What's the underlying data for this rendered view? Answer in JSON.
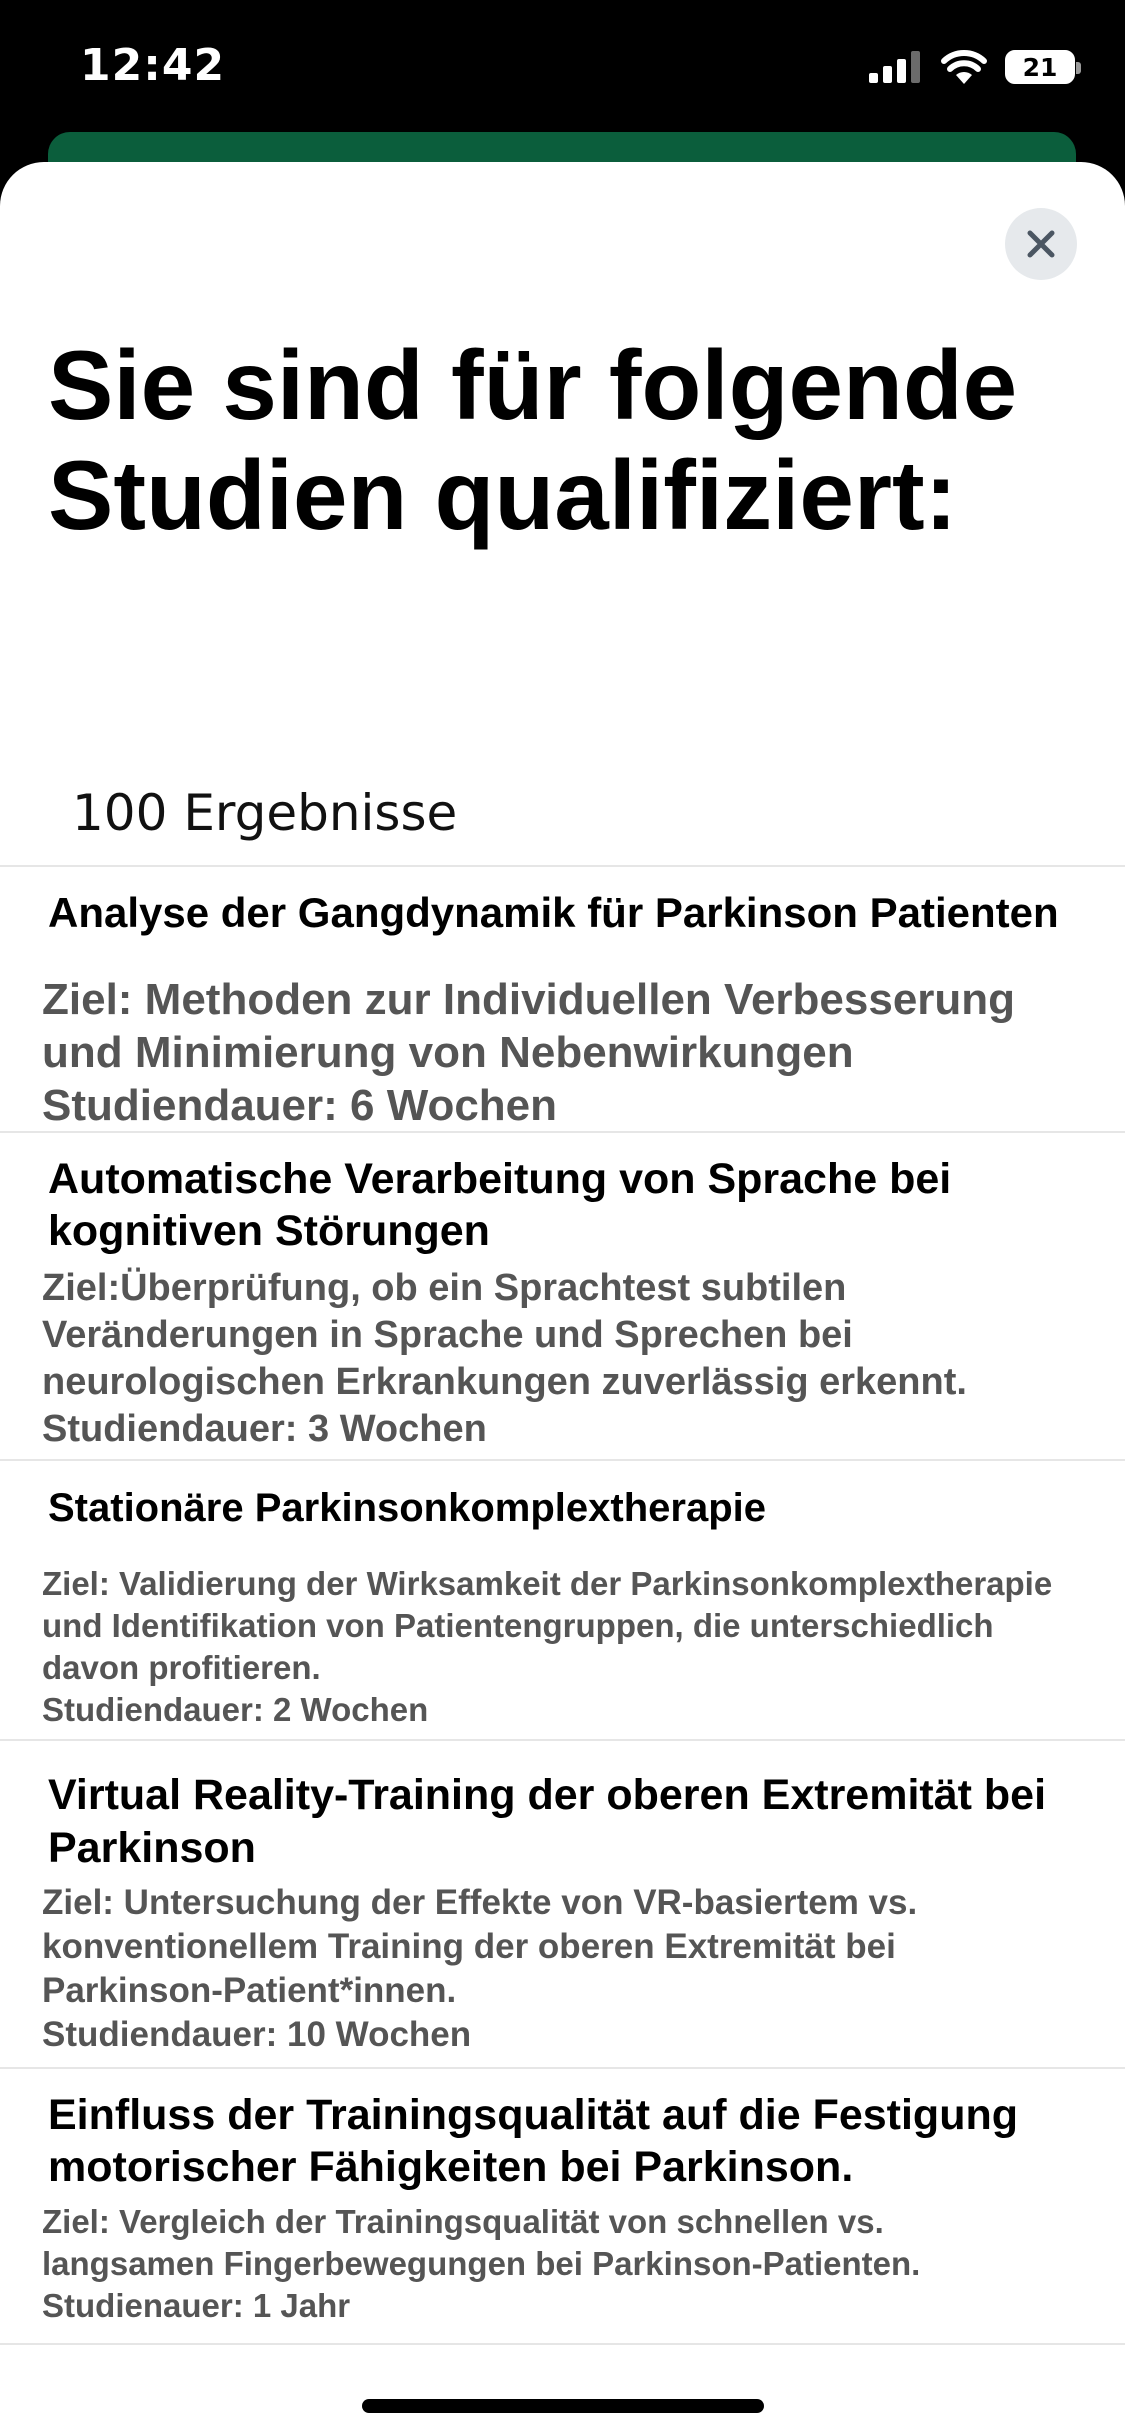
{
  "status_bar": {
    "time": "12:42",
    "battery": "21"
  },
  "header": {
    "title": "Sie sind für folgende Studien qualifiziert:",
    "close_icon": "close-icon"
  },
  "results": {
    "count_label": "100 Ergebnisse"
  },
  "studies": [
    {
      "title": "Analyse der Gangdynamik für Parkinson Patienten",
      "description": "Ziel: Methoden zur Individuellen Verbesserung und Minimierung von Nebenwirkungen\nStudiendauer: 6 Wochen"
    },
    {
      "title": "Automatische Verarbeitung von Sprache bei kognitiven Störungen",
      "description": "Ziel:Überprüfung, ob ein Sprachtest subtilen Veränderungen in Sprache und Sprechen bei neurologischen Erkrankungen zuverlässig erkennt.\nStudiendauer: 3 Wochen"
    },
    {
      "title": "Stationäre Parkinsonkomplextherapie",
      "description": "Ziel: Validierung der Wirksamkeit der Parkinsonkomplextherapie und Identifikation von Patientengruppen, die unterschiedlich davon profitieren.\nStudiendauer: 2 Wochen"
    },
    {
      "title": "Virtual Reality-Training der oberen Extremität bei Parkinson",
      "description": "Ziel: Untersuchung der Effekte von VR-basiertem vs. konventionellem Training der oberen Extremität bei Parkinson-Patient*innen.\nStudiendauer: 10 Wochen"
    },
    {
      "title": "Einfluss der Trainingsqualität auf die Festigung motorischer Fähigkeiten bei Parkinson.",
      "description": "Ziel: Vergleich der Trainingsqualität von schnellen vs. langsamen Fingerbewegungen bei Parkinson-Patienten.\nStudienauer: 1 Jahr"
    }
  ],
  "colors": {
    "accent_green": "#0b5e3c",
    "description_gray": "#555555",
    "close_button_bg": "#e6e9ec"
  }
}
